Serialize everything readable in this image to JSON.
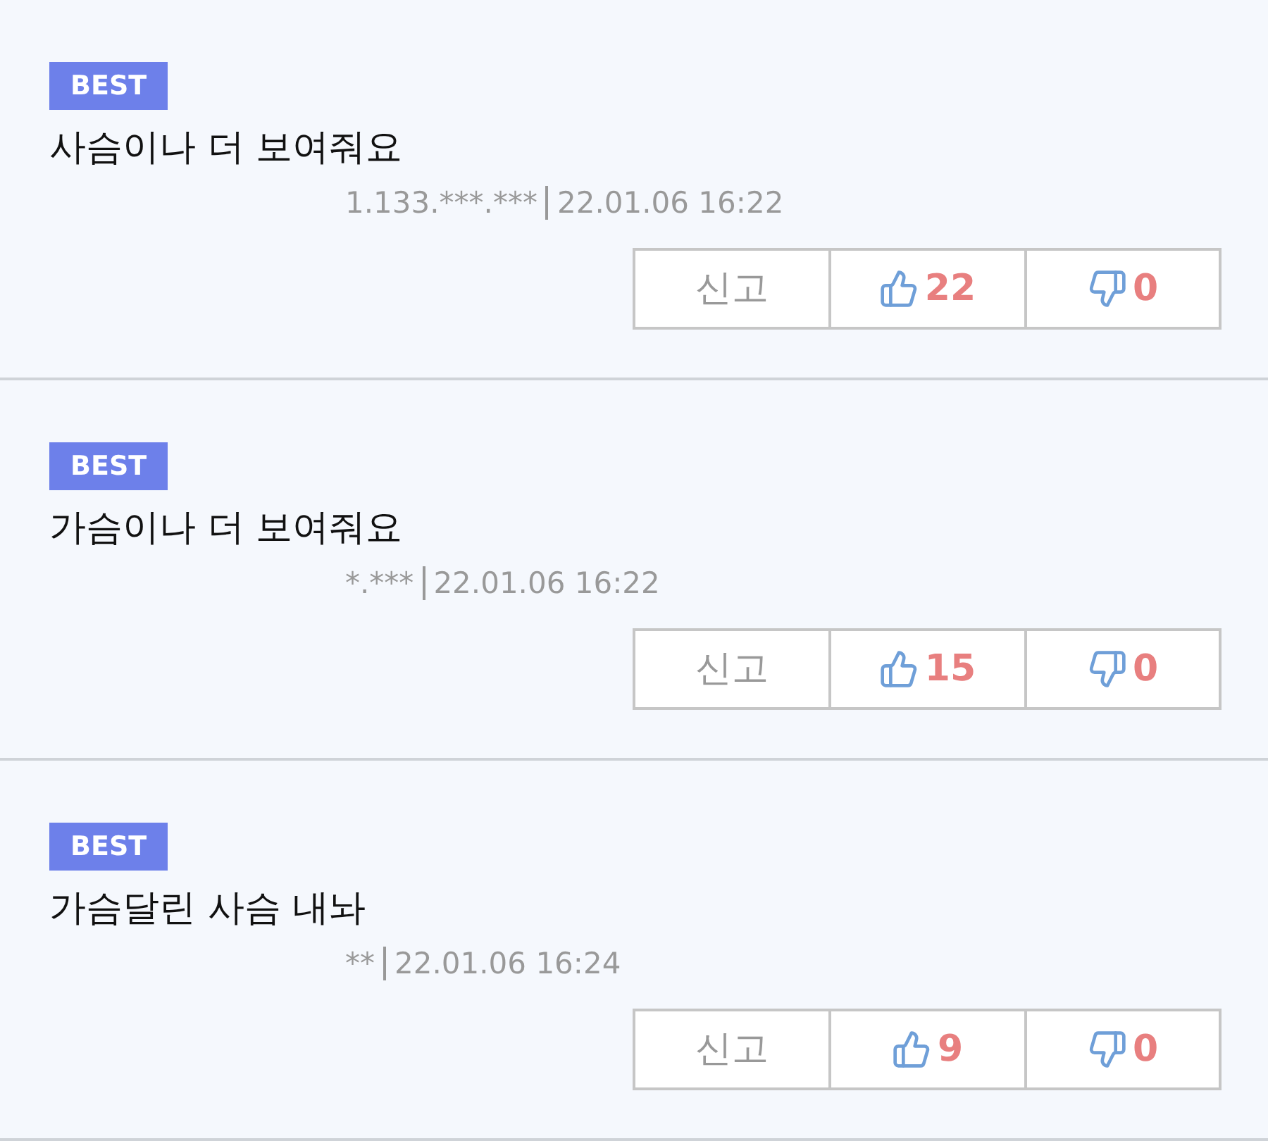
{
  "comments": [
    {
      "badge": "BEST",
      "text": "사슴이나 더 보여줘요",
      "ip": "1.133.***.***",
      "date": "22.01.06 16:22",
      "report": "신고",
      "likes": "22",
      "dislikes": "0"
    },
    {
      "badge": "BEST",
      "text": "가슴이나 더 보여줘요",
      "ip": "*.***",
      "date": "22.01.06 16:22",
      "report": "신고",
      "likes": "15",
      "dislikes": "0"
    },
    {
      "badge": "BEST",
      "text": "가슴달린 사슴 내놔",
      "ip": "**",
      "date": "22.01.06 16:24",
      "report": "신고",
      "likes": "9",
      "dislikes": "0"
    }
  ]
}
